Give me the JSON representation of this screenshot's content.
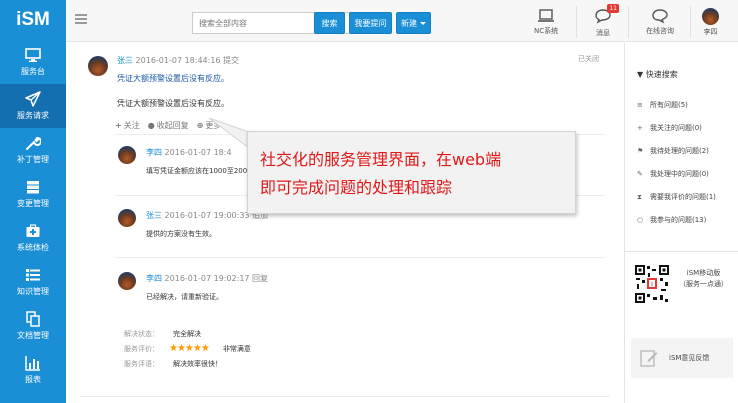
{
  "logo": {
    "text": "iSM"
  },
  "sidebar": {
    "items": [
      {
        "label": "服务台",
        "icon": "monitor-icon"
      },
      {
        "label": "服务请求",
        "icon": "send-icon",
        "active": true
      },
      {
        "label": "补丁管理",
        "icon": "wrench-icon"
      },
      {
        "label": "变更管理",
        "icon": "server-icon"
      },
      {
        "label": "系统体检",
        "icon": "medkit-icon"
      },
      {
        "label": "知识管理",
        "icon": "list-icon"
      },
      {
        "label": "文档管理",
        "icon": "copy-icon"
      },
      {
        "label": "报表",
        "icon": "bar-chart-icon"
      }
    ]
  },
  "topbar": {
    "search_placeholder": "搜索全部内容",
    "search_button": "搜索",
    "ask_button": "我要提问",
    "new_button": "新建",
    "nc_label": "NC系统",
    "msg_label": "消息",
    "msg_count": "11",
    "consult_label": "在线咨询",
    "user_label": "李四"
  },
  "post": {
    "author": "张三",
    "time": "2016-01-07 18:44:16 提交",
    "status": "已关闭",
    "title": "凭证大额预警设置后没有反应。",
    "body": "凭证大额预警设置后没有反应。",
    "follow": "关注",
    "collapse_reply": "收起回复",
    "more": "更多"
  },
  "replies": [
    {
      "author": "李四",
      "time": "2016-01-07 18:4",
      "text": "填写凭证金额应该在1000至2000"
    },
    {
      "author": "张三",
      "time": "2016-01-07 19:00:33 追加",
      "text": "提供的方案没有生效。"
    },
    {
      "author": "李四",
      "time": "2016-01-07 19:02:17 回复",
      "text": "已经解决，请重新验证。"
    }
  ],
  "resolution": {
    "status_label": "解决状态：",
    "status_value": "完全解决",
    "rating_label": "服务评价：",
    "rating_stars": "★★★★★",
    "rating_text": "非常满意",
    "comment_label": "服务评语：",
    "comment_value": "解决效率很快！"
  },
  "callout": {
    "line1": "社交化的服务管理界面，在web端",
    "line2": "即可完成问题的处理和跟踪"
  },
  "right_panel": {
    "title": "快速搜索",
    "items": [
      {
        "label": "所有问题(5)",
        "icon": "list-icon"
      },
      {
        "label": "我关注的问题(0)",
        "icon": "plus-icon"
      },
      {
        "label": "我待处理的问题(2)",
        "icon": "flag-icon"
      },
      {
        "label": "我处理中的问题(0)",
        "icon": "edit-icon"
      },
      {
        "label": "需要我评价的问题(1)",
        "icon": "hourglass-icon"
      },
      {
        "label": "我参与的问题(13)",
        "icon": "comment-icon"
      }
    ],
    "mobile_line1": "iSM移动版",
    "mobile_line2": "（服务一点通）",
    "feedback": "iSM意见反馈"
  }
}
